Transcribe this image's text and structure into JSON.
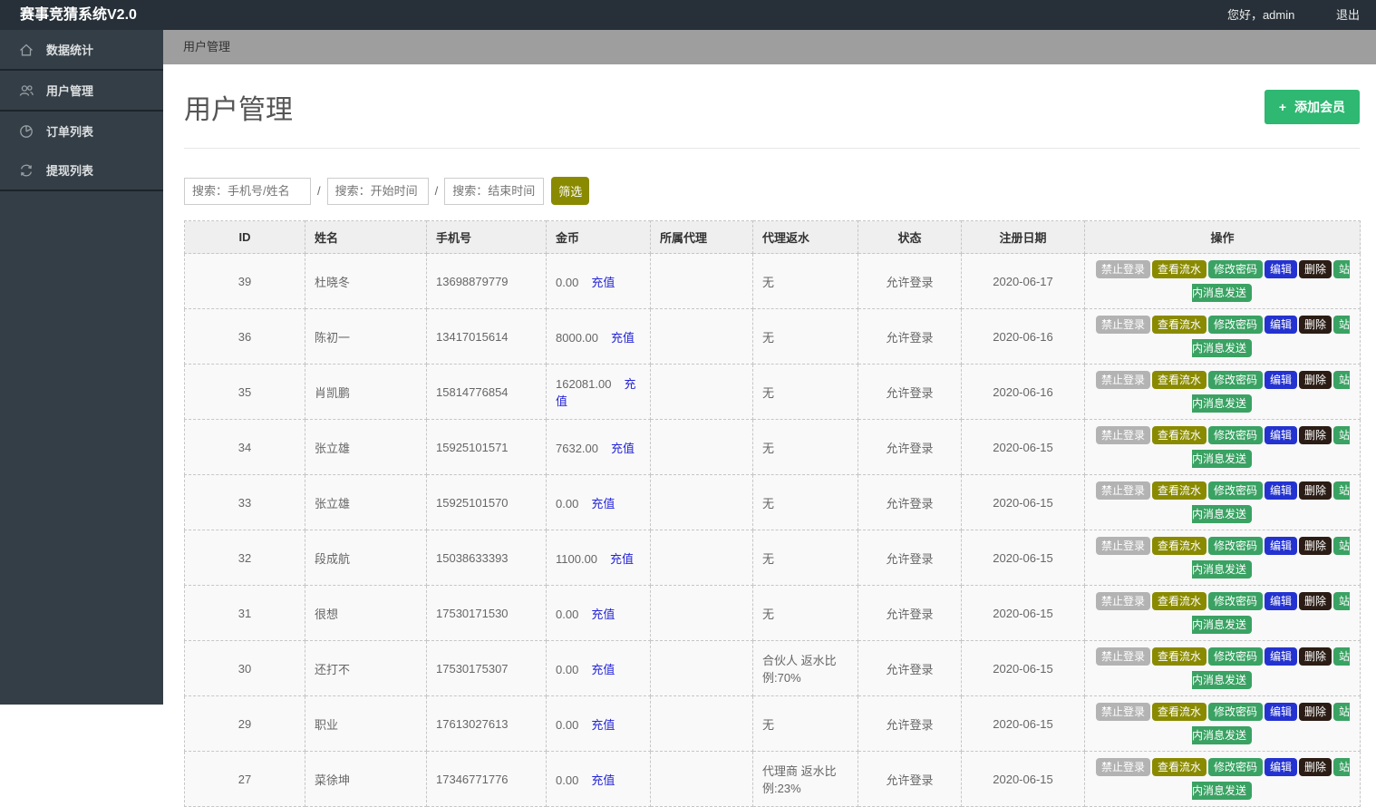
{
  "app": {
    "title": "赛事竞猜系统V2.0",
    "greeting": "您好，admin",
    "logout_label": "退出"
  },
  "sidebar": {
    "items": [
      {
        "label": "数据统计",
        "icon": "home-icon",
        "divider_after": true
      },
      {
        "label": "用户管理",
        "icon": "users-icon",
        "divider_after": true
      },
      {
        "label": "订单列表",
        "icon": "pie-chart-icon",
        "divider_after": false
      },
      {
        "label": "提现列表",
        "icon": "refresh-icon",
        "divider_after": true
      }
    ]
  },
  "breadcrumb": "用户管理",
  "page": {
    "title": "用户管理",
    "add_button_label": "添加会员",
    "add_button_icon": "plus-icon"
  },
  "search": {
    "name_placeholder": "搜索：手机号/姓名",
    "start_placeholder": "搜索：开始时间",
    "end_placeholder": "搜索：结束时间",
    "separator": "/",
    "filter_button_label": "筛选"
  },
  "table": {
    "headers": [
      "ID",
      "姓名",
      "手机号",
      "金币",
      "所属代理",
      "代理返水",
      "状态",
      "注册日期",
      "操作"
    ],
    "recharge_label": "充值",
    "action_labels": [
      "禁止登录",
      "查看流水",
      "修改密码",
      "编辑",
      "删除",
      "站内消息发送"
    ],
    "rows": [
      {
        "id": "39",
        "name": "杜晓冬",
        "phone": "13698879779",
        "coins": "0.00",
        "agent": "",
        "rebate": "无",
        "status": "允许登录",
        "date": "2020-06-17"
      },
      {
        "id": "36",
        "name": "陈初一",
        "phone": "13417015614",
        "coins": "8000.00",
        "agent": "",
        "rebate": "无",
        "status": "允许登录",
        "date": "2020-06-16"
      },
      {
        "id": "35",
        "name": "肖凯鹏",
        "phone": "15814776854",
        "coins": "162081.00",
        "agent": "",
        "rebate": "无",
        "status": "允许登录",
        "date": "2020-06-16"
      },
      {
        "id": "34",
        "name": "张立雄",
        "phone": "15925101571",
        "coins": "7632.00",
        "agent": "",
        "rebate": "无",
        "status": "允许登录",
        "date": "2020-06-15"
      },
      {
        "id": "33",
        "name": "张立雄",
        "phone": "15925101570",
        "coins": "0.00",
        "agent": "",
        "rebate": "无",
        "status": "允许登录",
        "date": "2020-06-15"
      },
      {
        "id": "32",
        "name": "段成航",
        "phone": "15038633393",
        "coins": "1100.00",
        "agent": "",
        "rebate": "无",
        "status": "允许登录",
        "date": "2020-06-15"
      },
      {
        "id": "31",
        "name": "很想",
        "phone": "17530171530",
        "coins": "0.00",
        "agent": "",
        "rebate": "无",
        "status": "允许登录",
        "date": "2020-06-15"
      },
      {
        "id": "30",
        "name": "还打不",
        "phone": "17530175307",
        "coins": "0.00",
        "agent": "",
        "rebate": "合伙人 返水比例:70%",
        "status": "允许登录",
        "date": "2020-06-15"
      },
      {
        "id": "29",
        "name": "职业",
        "phone": "17613027613",
        "coins": "0.00",
        "agent": "",
        "rebate": "无",
        "status": "允许登录",
        "date": "2020-06-15"
      },
      {
        "id": "27",
        "name": "菜徐坤",
        "phone": "17346771776",
        "coins": "0.00",
        "agent": "",
        "rebate": "代理商 返水比例:23%",
        "status": "允许登录",
        "date": "2020-06-15"
      }
    ]
  },
  "colors": {
    "topbar_bg": "#273038",
    "sidebar_bg": "#343e46",
    "breadcrumb_bg": "#9e9e9e",
    "add_button_green": "#2eb872",
    "filter_olive": "#8a8a00",
    "action_gray": "#b3b3b3",
    "action_olive": "#8a8a00",
    "action_green": "#3aa263",
    "action_blue": "#2433d0",
    "action_dark": "#2b1d15",
    "link_blue": "#2525d8"
  }
}
